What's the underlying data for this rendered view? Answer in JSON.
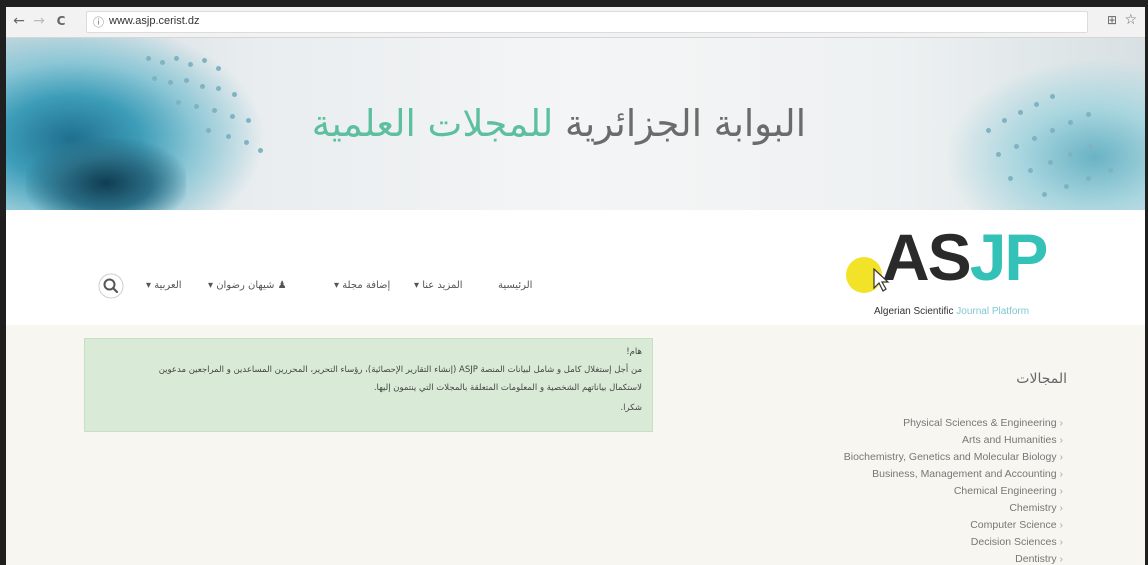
{
  "browser": {
    "url": "www.asjp.cerist.dz",
    "back_glyph": "←",
    "forward_glyph": "→",
    "reload_glyph": "C",
    "info_glyph": "ⓘ",
    "star_glyph": "☆",
    "translate_glyph": "⊞"
  },
  "banner": {
    "title_main": "البوابة الجزائرية",
    "title_accent": "للمجلات العلمية",
    "accent_color": "#5cbf9e"
  },
  "logo": {
    "part1": "AS",
    "part2": "JP",
    "sub1": "Algerian Scientific",
    "sub2": "Journal Platform",
    "accent_color": "#34c1b8"
  },
  "nav": {
    "items": [
      {
        "label": "الرئيسية"
      },
      {
        "label": "المزيد عنا ▾"
      },
      {
        "label": "إضافة مجلة ▾"
      },
      {
        "label": "شيهان رضوان ▾"
      },
      {
        "label": "العربية ▾"
      }
    ],
    "search_icon": "search-icon",
    "user_icon": "user-icon"
  },
  "notice": {
    "lines": [
      "هام!",
      "من أجل إستغلال كامل و شامل لبيانات المنصة ASJP (إنشاء التقارير الإحصائية)، رؤساء التحرير، المحررين المساعدين و المراجعين مدعوين",
      "لاستكمال بياناتهم الشخصية و المعلومات المتعلقة بالمجلات التي ينتمون إليها.",
      "شكرا."
    ]
  },
  "fields": {
    "title": "المجالات",
    "items": [
      "Physical Sciences & Engineering",
      "Arts and Humanities",
      "Biochemistry, Genetics and Molecular Biology",
      "Business, Management and Accounting",
      "Chemical Engineering",
      "Chemistry",
      "Computer Science",
      "Decision Sciences",
      "Dentistry"
    ]
  }
}
